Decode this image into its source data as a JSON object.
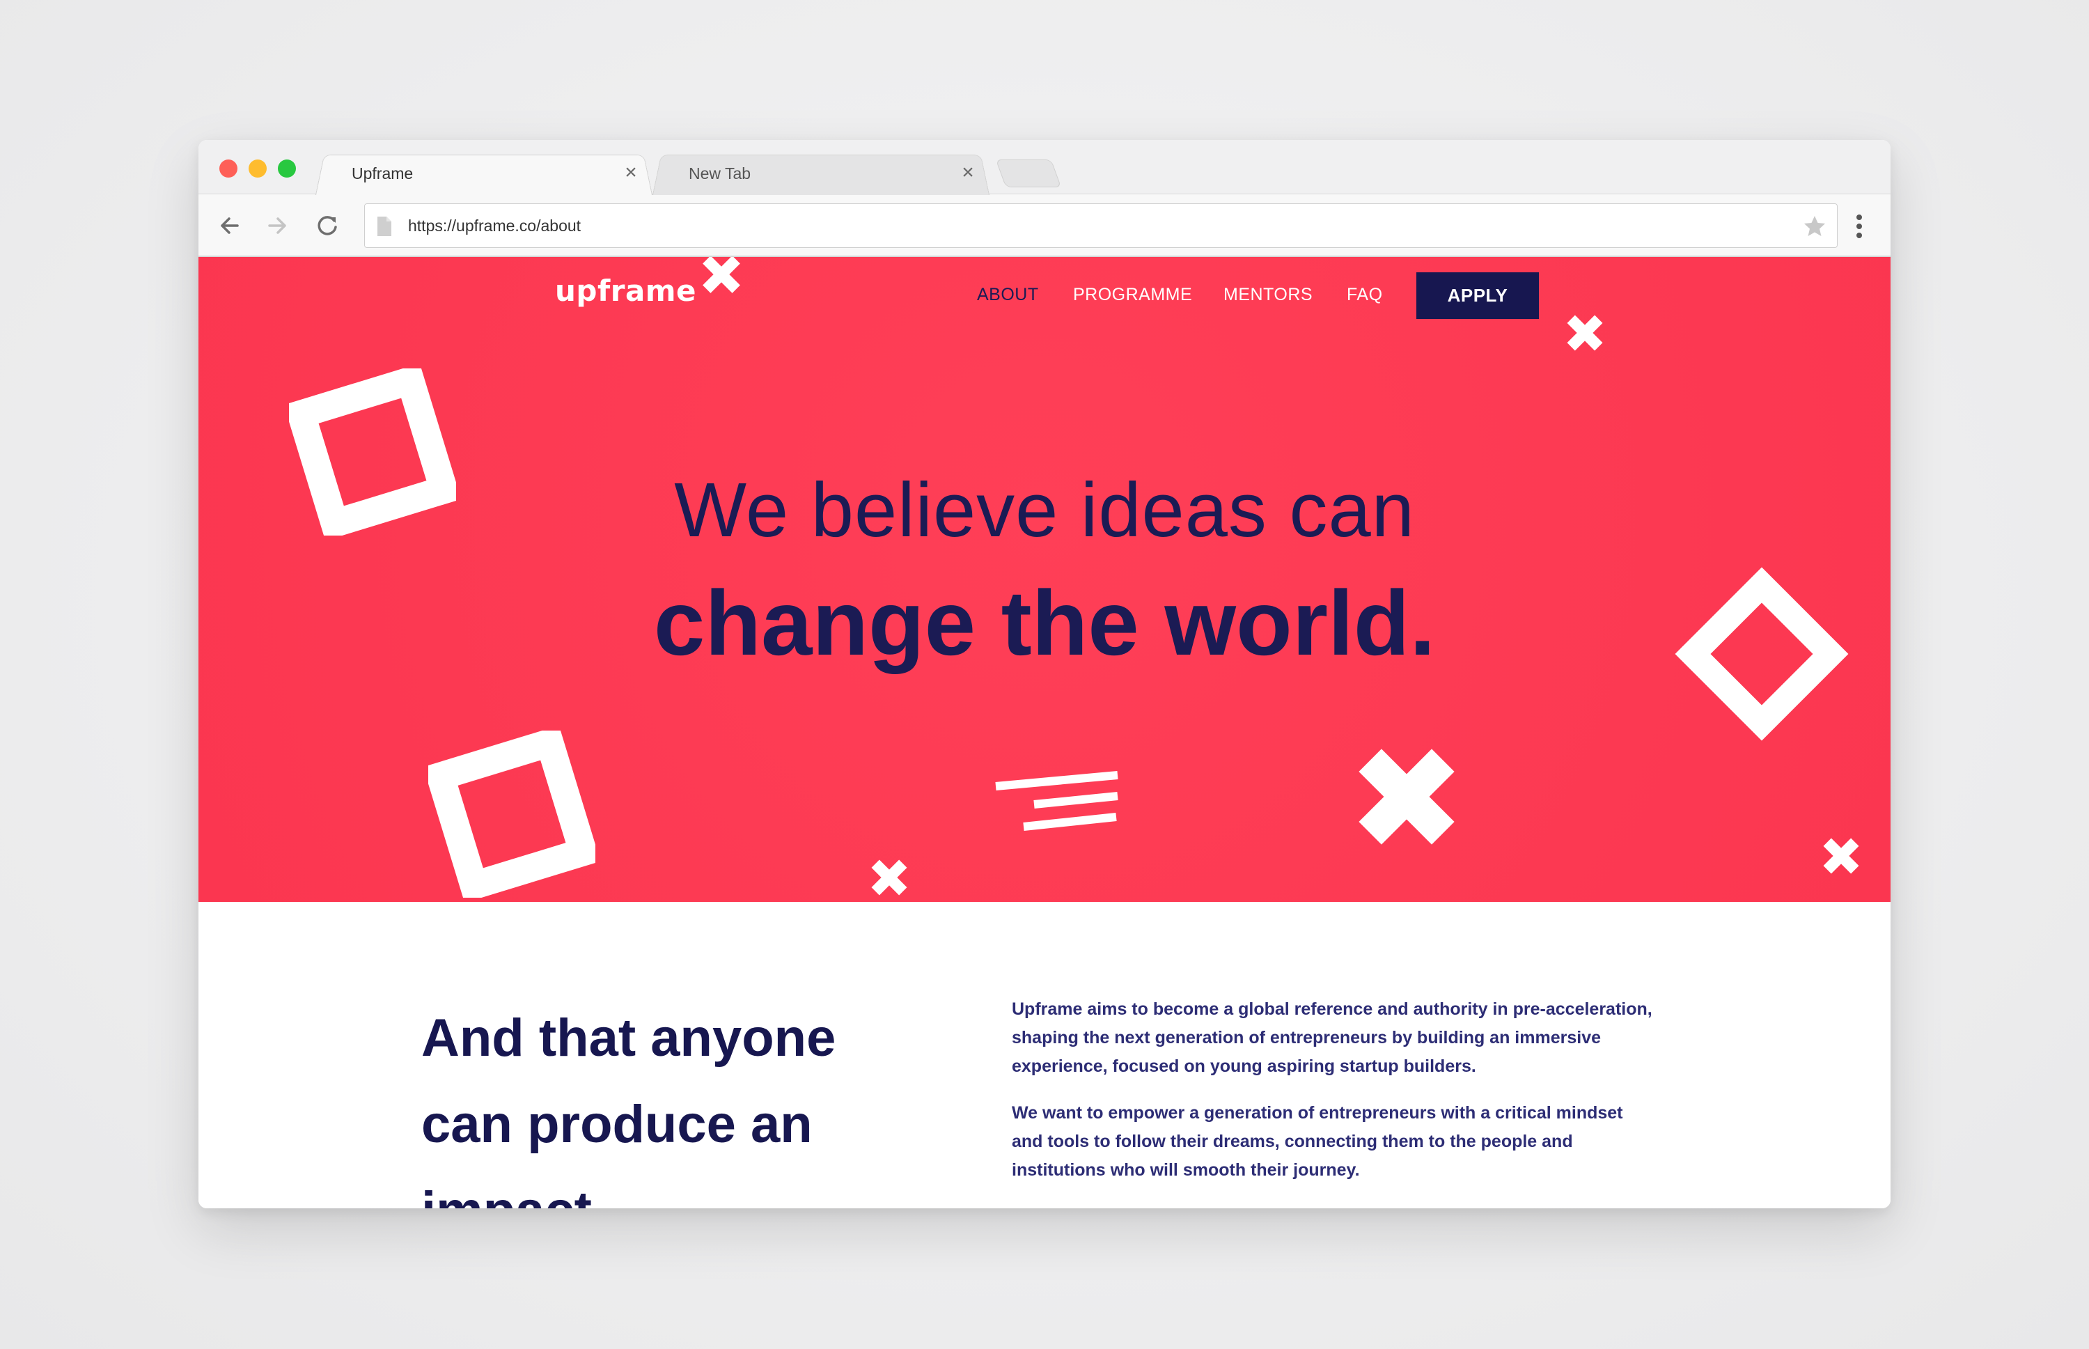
{
  "browser": {
    "tabs": [
      {
        "label": "Upframe",
        "active": true
      },
      {
        "label": "New Tab",
        "active": false
      }
    ],
    "close_glyph": "×",
    "url": "https://upframe.co/about",
    "icons": {
      "back": "back-arrow-icon",
      "forward": "forward-arrow-icon",
      "reload": "reload-icon",
      "page": "page-icon",
      "bookmark": "star-icon",
      "menu": "more-vert-icon"
    }
  },
  "site": {
    "logo": "upframe",
    "nav": [
      {
        "label": "ABOUT",
        "active": true
      },
      {
        "label": "PROGRAMME",
        "active": false
      },
      {
        "label": "MENTORS",
        "active": false
      },
      {
        "label": "FAQ",
        "active": false
      }
    ],
    "apply": "APPLY",
    "hero": {
      "line1": "We believe ideas can",
      "line2": "change the world."
    },
    "about": {
      "heading": "And that anyone can produce an impact",
      "paragraph1": "Upframe aims to become a global reference and authority in pre-acceleration, shaping the next generation of entrepreneurs by building an immersive experience, focused on young aspiring startup builders.",
      "paragraph2": "We want to empower a generation of entrepreneurs with a critical mindset and tools to follow their dreams, connecting them to the people and institutions who will smooth their journey."
    }
  },
  "colors": {
    "hero_background": "#fe3a53",
    "navy": "#171750",
    "text_blue": "#2d2d75",
    "white": "#ffffff"
  }
}
